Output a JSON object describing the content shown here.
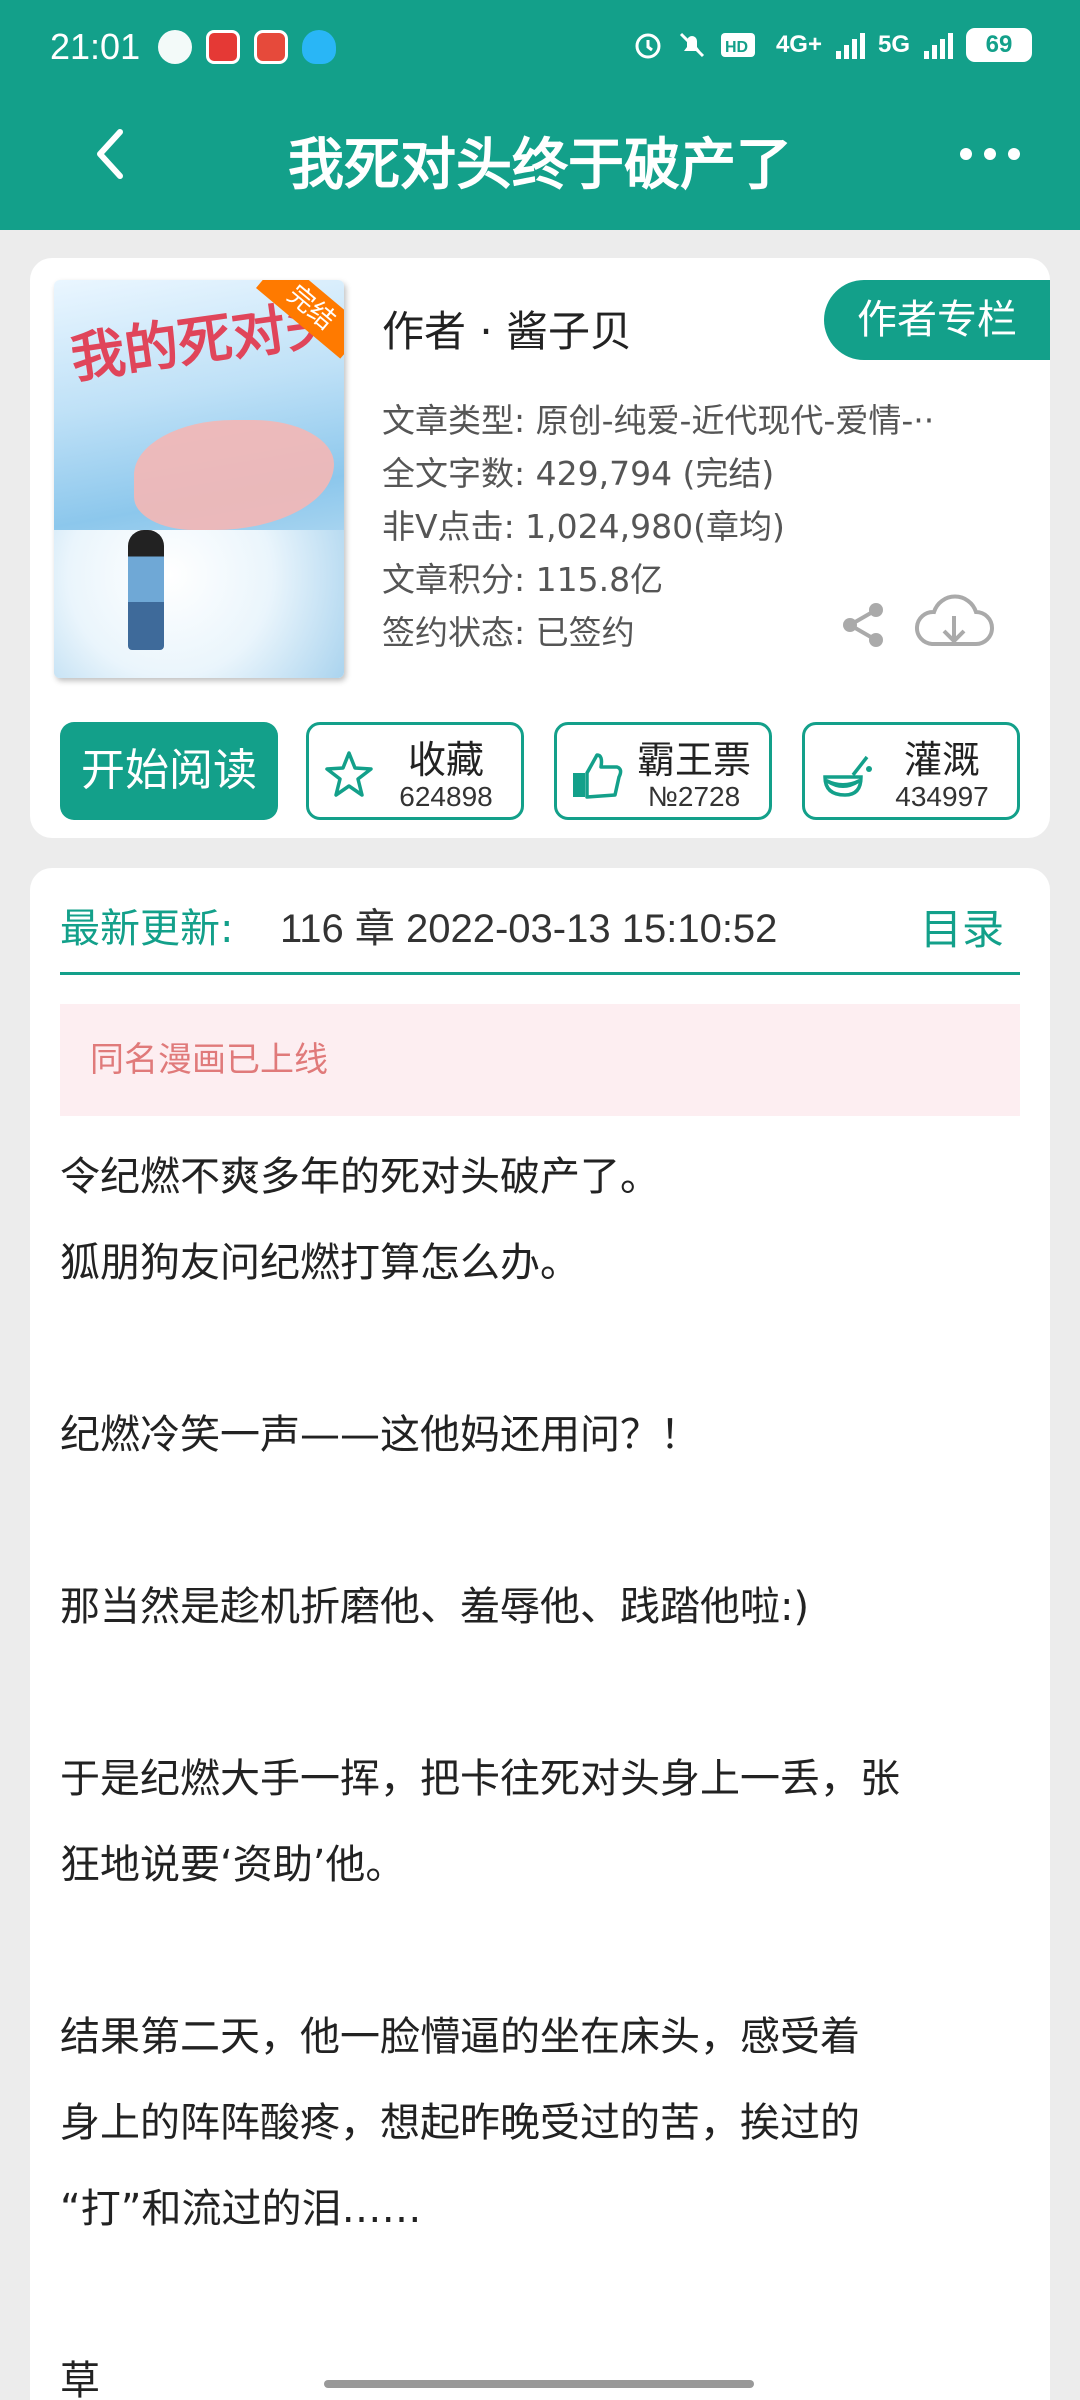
{
  "status_bar": {
    "time": "21:01",
    "network_1": "4G+",
    "network_2": "5G",
    "battery": "69",
    "icons": [
      "wechat-icon",
      "app-icon",
      "app-icon",
      "qq-icon",
      "alarm-icon",
      "mute-icon",
      "hd-icon",
      "signal-icon",
      "battery-icon"
    ]
  },
  "header": {
    "title": "我死对头终于破产了",
    "back_icon": "chevron-left-icon",
    "more_icon": "more-dots-icon"
  },
  "book": {
    "cover_title": "我的死对头",
    "cover_badge": "完结",
    "author": "作者 · 酱子贝",
    "author_column_label": "作者专栏",
    "meta": [
      "文章类型: 原创-纯爱-近代现代-爱情-··",
      "全文字数: 429,794 (完结)",
      "非V点击: 1,024,980(章均)",
      "文章积分: 115.8亿",
      "签约状态: 已签约"
    ],
    "share_icon": "share-icon",
    "download_icon": "cloud-download-icon"
  },
  "actions": {
    "read_label": "开始阅读",
    "favorite": {
      "label": "收藏",
      "count": "624898"
    },
    "overlord_ticket": {
      "label": "霸王票",
      "count": "№2728"
    },
    "water": {
      "label": "灌溉",
      "count": "434997"
    }
  },
  "content": {
    "latest_label": "最新更新:",
    "latest_text": "116 章  2022-03-13 15:10:52",
    "toc_label": "目录",
    "notice": "同名漫画已上线",
    "intro": [
      "令纪燃不爽多年的死对头破产了。",
      "狐朋狗友问纪燃打算怎么办。",
      "",
      "纪燃冷笑一声——这他妈还用问？！",
      "",
      "那当然是趁机折磨他、羞辱他、践踏他啦:)",
      "",
      "于是纪燃大手一挥，把卡往死对头身上一丢，张",
      "狂地说要‘资助’他。",
      "",
      "结果第二天，他一脸懵逼的坐在床头，感受着",
      "身上的阵阵酸疼，想起昨晚受过的苦，挨过的",
      "“打”和流过的泪……",
      "",
      "草"
    ]
  },
  "colors": {
    "accent": "#13a08a",
    "notice_bg": "#fdeef1",
    "notice_text": "#e07a7a"
  }
}
